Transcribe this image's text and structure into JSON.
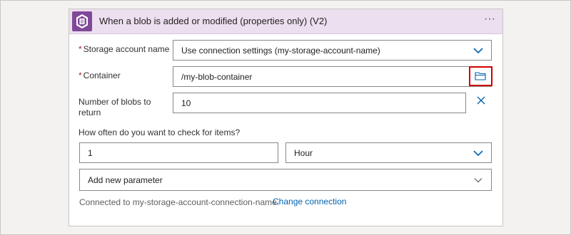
{
  "card": {
    "title": "When a blob is added or modified (properties only) (V2)",
    "header_color": "#ecdfef",
    "icon": "blob-storage-icon",
    "icon_color": "#804998",
    "more_label": "···"
  },
  "fields": {
    "storage_account": {
      "required_mark": "*",
      "label": "Storage account name",
      "value": "Use connection settings (my-storage-account-name)"
    },
    "container": {
      "required_mark": "*",
      "label": "Container",
      "value": "/my-blob-container",
      "picker_icon": "folder-icon"
    },
    "number_of_blobs": {
      "label_line1": "Number of blobs to",
      "label_line2": "return",
      "value": "10",
      "clear_icon": "close-icon"
    },
    "recurrence": {
      "label": "How often do you want to check for items?",
      "interval": "1",
      "frequency": "Hour"
    },
    "add_parameter": {
      "label": "Add new parameter"
    }
  },
  "footer": {
    "connected_text": "Connected to my-storage-account-connection-name.",
    "change_link": "Change connection"
  },
  "colors": {
    "accent": "#0062ad",
    "highlight_border": "#d00000",
    "required": "#a4262c"
  }
}
